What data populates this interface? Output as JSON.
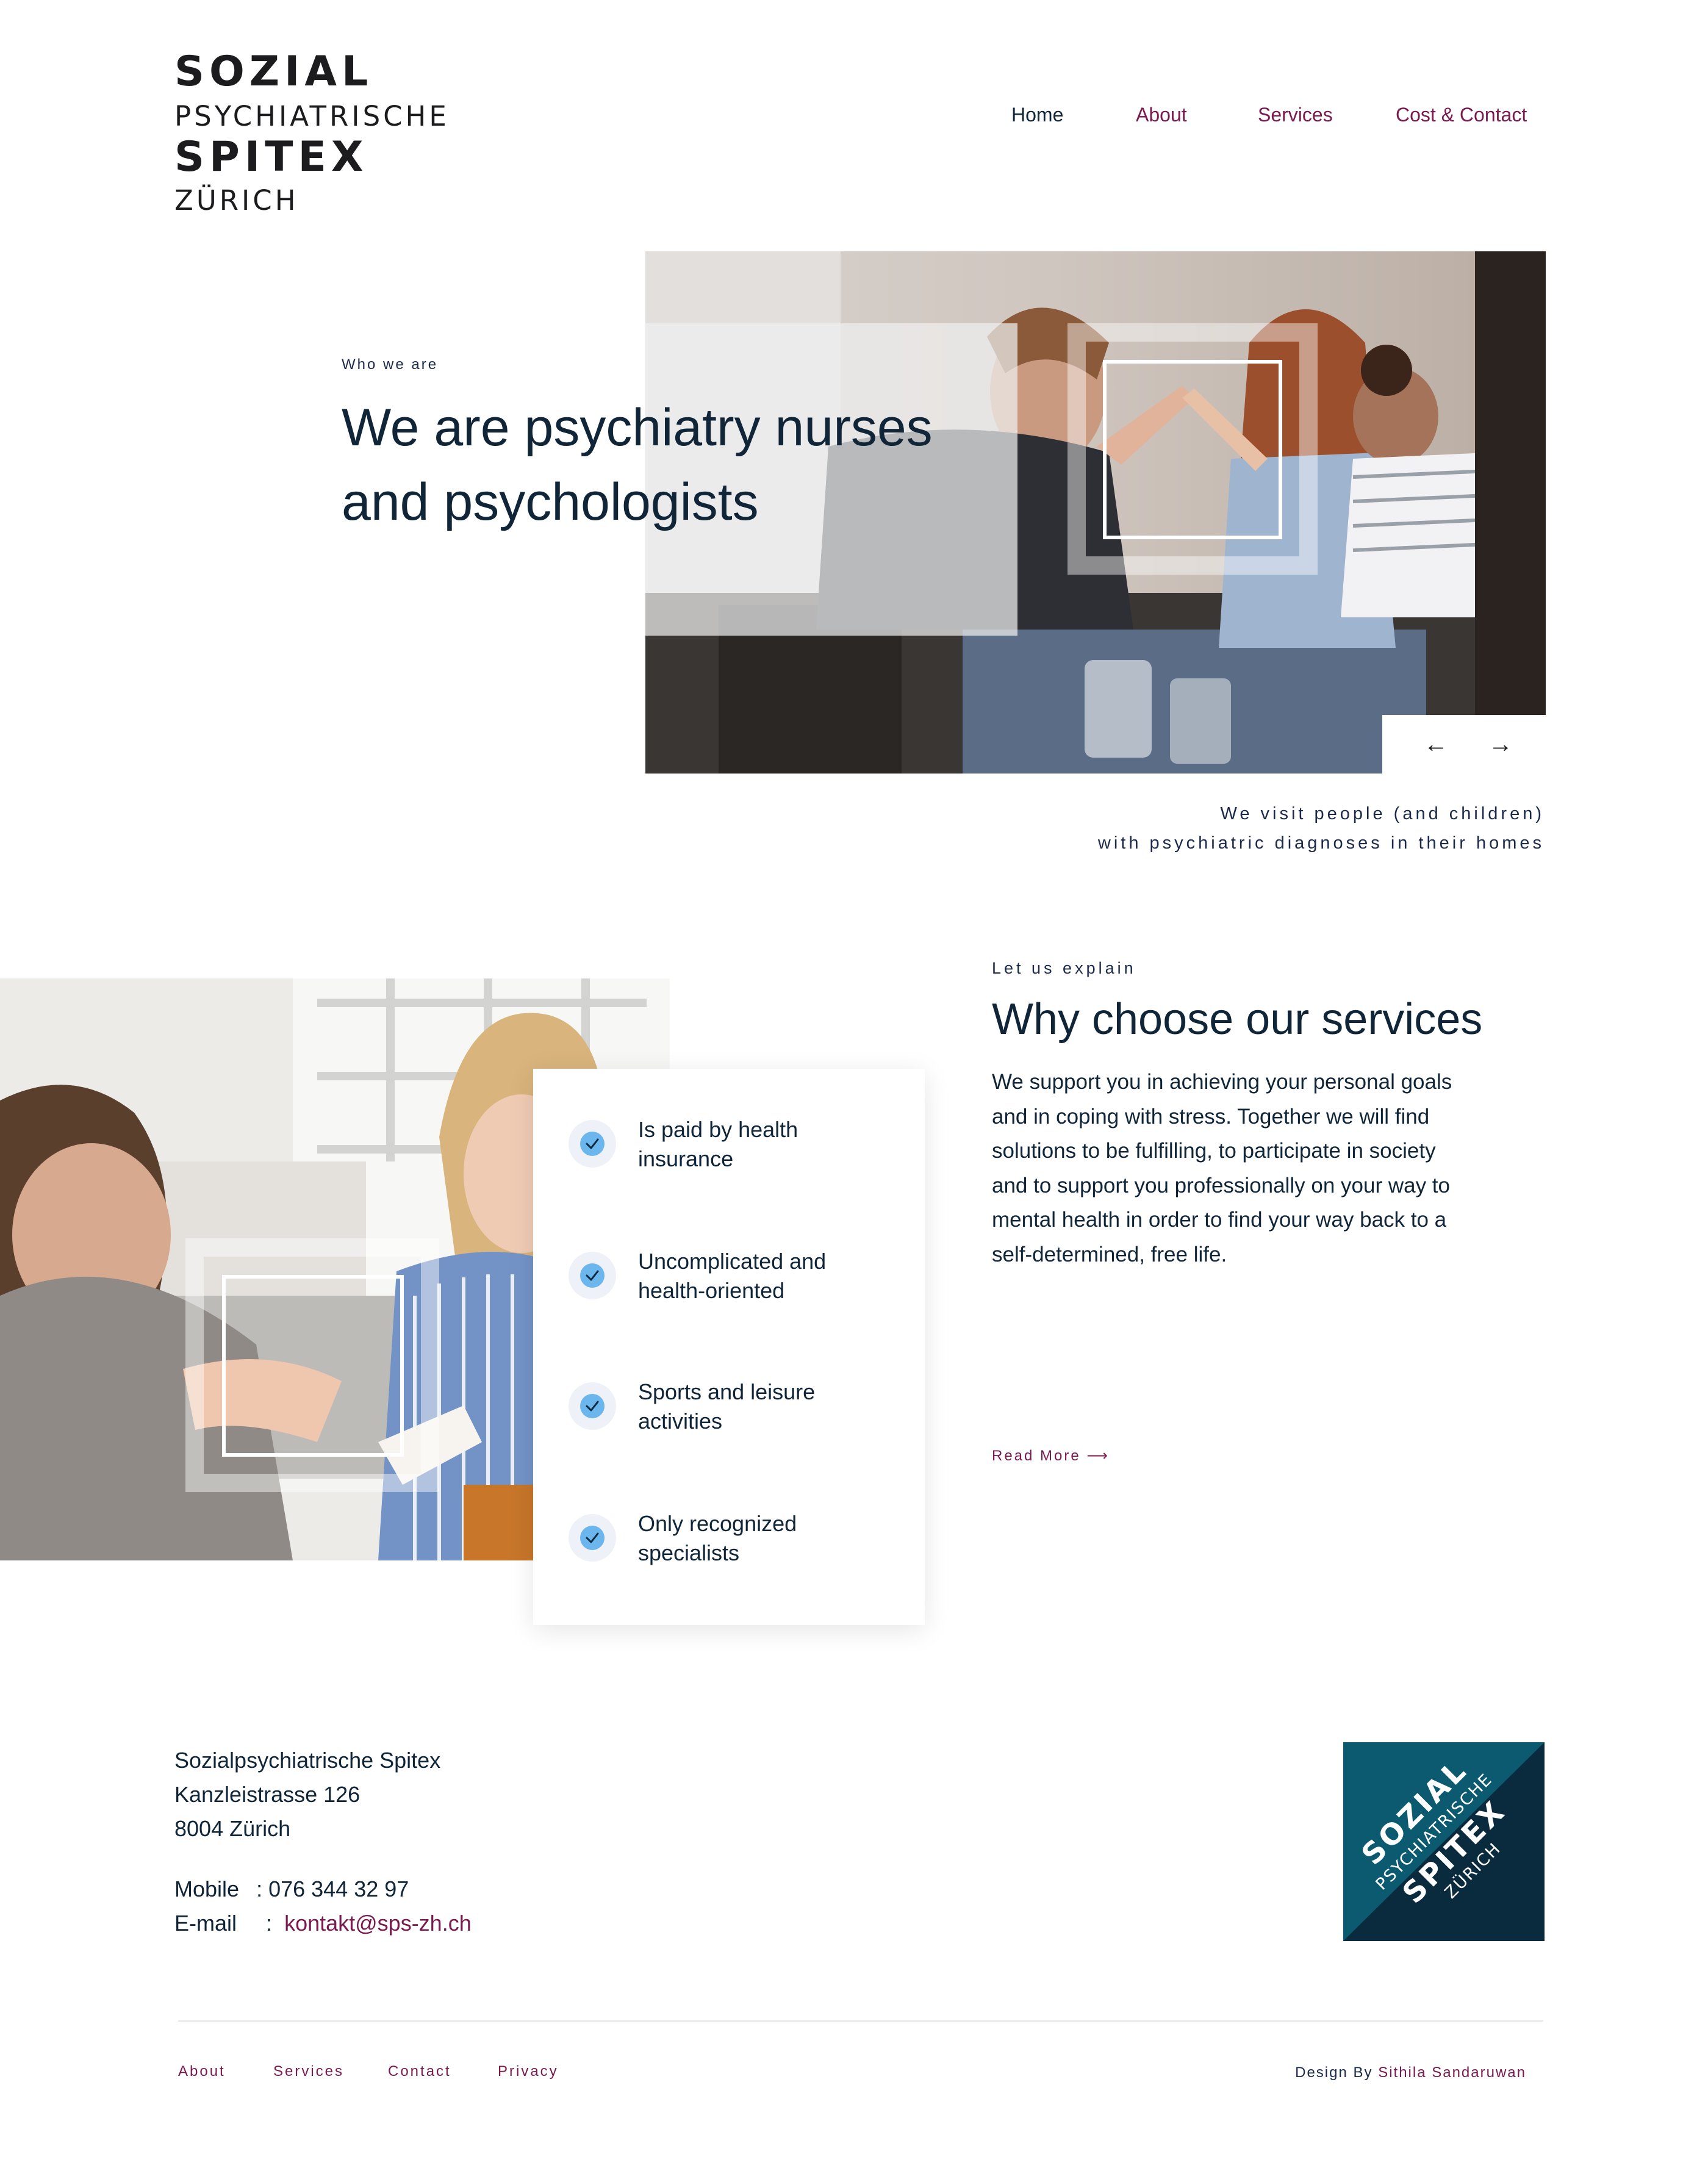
{
  "brand": {
    "line1": "SOZIAL",
    "line2": "PSYCHIATRISCHE",
    "line3": "SPITEX",
    "line4": "ZÜRICH"
  },
  "nav": {
    "items": [
      {
        "label": "Home"
      },
      {
        "label": "About"
      },
      {
        "label": "Services"
      },
      {
        "label": "Cost & Contact"
      }
    ]
  },
  "hero": {
    "eyebrow": "Who we are",
    "title_line1": "We are psychiatry nurses",
    "title_line2": "and psychologists",
    "prev_icon": "←",
    "next_icon": "→",
    "caption_line1": "We visit people (and children)",
    "caption_line2": "with psychiatric diagnoses in their homes"
  },
  "services": {
    "eyebrow": "Let us explain",
    "title": "Why choose our services",
    "body": "We support you in achieving your personal goals and in coping with stress. Together we will find solutions to be fulfilling, to participate in society and to support you professionally on your way to mental health in order to find your way back to a self-determined, free life.",
    "read_more": "Read More",
    "read_more_icon": "⟶",
    "features": [
      {
        "label": "Is paid by health insurance"
      },
      {
        "label": "Uncomplicated and health-oriented"
      },
      {
        "label": "Sports and leisure activities"
      },
      {
        "label": "Only recognized specialists"
      }
    ]
  },
  "footer": {
    "address": [
      "Sozialpsychiatrische Spitex",
      "Kanzleistrasse 126",
      "8004 Zürich"
    ],
    "mobile_label": "Mobile",
    "mobile_value": ": 076 344 32 97",
    "email_label": "E-mail",
    "email_sep": ":",
    "email_value": "kontakt@sps-zh.ch",
    "links": [
      {
        "label": "About"
      },
      {
        "label": "Services"
      },
      {
        "label": "Contact"
      },
      {
        "label": "Privacy"
      }
    ],
    "credit_prefix": "Design By",
    "credit_name": "Sithila Sandaruwan"
  },
  "badge": {
    "line1": "SOZIAL",
    "line2": "PSYCHIATRISCHE",
    "line3": "SPITEX",
    "line4": "ZÜRICH"
  },
  "colors": {
    "accent": "#7a1a4f",
    "text": "#102638",
    "check": "#6cb6ee",
    "badge_dark": "#0a2b3e",
    "badge_teal": "#0b5a70"
  },
  "icons": [
    "check-icon",
    "arrow-left-icon",
    "arrow-right-icon",
    "arrow-long-right-icon"
  ]
}
